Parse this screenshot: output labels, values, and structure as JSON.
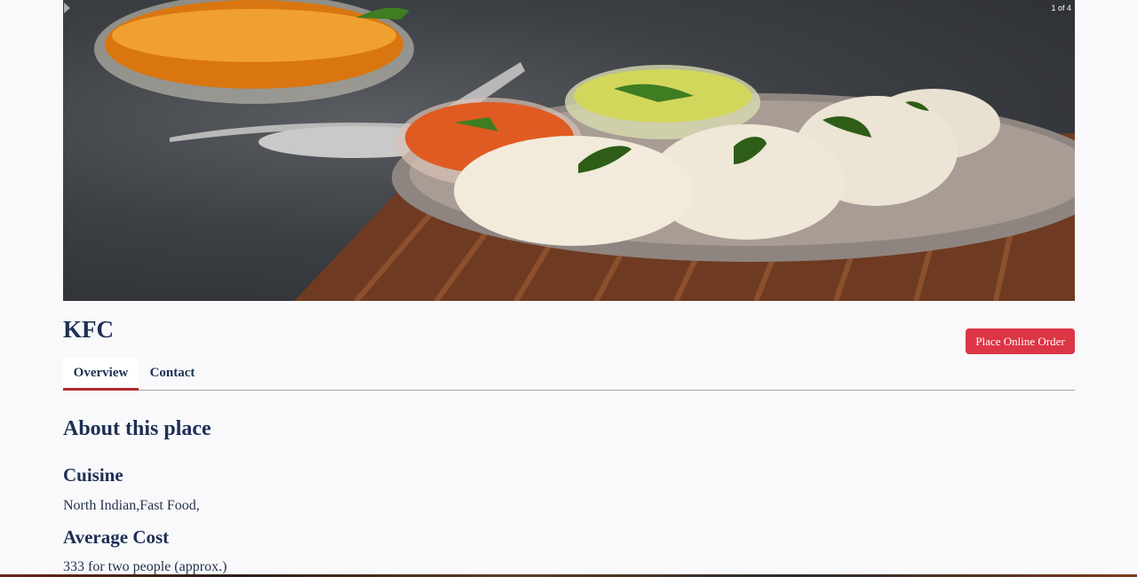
{
  "carousel": {
    "counter": "1 of 4",
    "next_icon": "chevron-right-icon",
    "image": "idli-plate-photo"
  },
  "restaurant": {
    "name": "KFC",
    "order_button": "Place Online Order"
  },
  "tabs": [
    {
      "label": "Overview",
      "active": true
    },
    {
      "label": "Contact",
      "active": false
    }
  ],
  "about": {
    "heading": "About this place",
    "cuisine_heading": "Cuisine",
    "cuisine_value": "North Indian,Fast Food,",
    "cost_heading": "Average Cost",
    "cost_value": "333 for two people (approx.)"
  },
  "colors": {
    "primary_text": "#1e2f55",
    "button": "#dc3545",
    "active_tab_underline": "#b52a2a",
    "background": "#f9f9fb"
  }
}
